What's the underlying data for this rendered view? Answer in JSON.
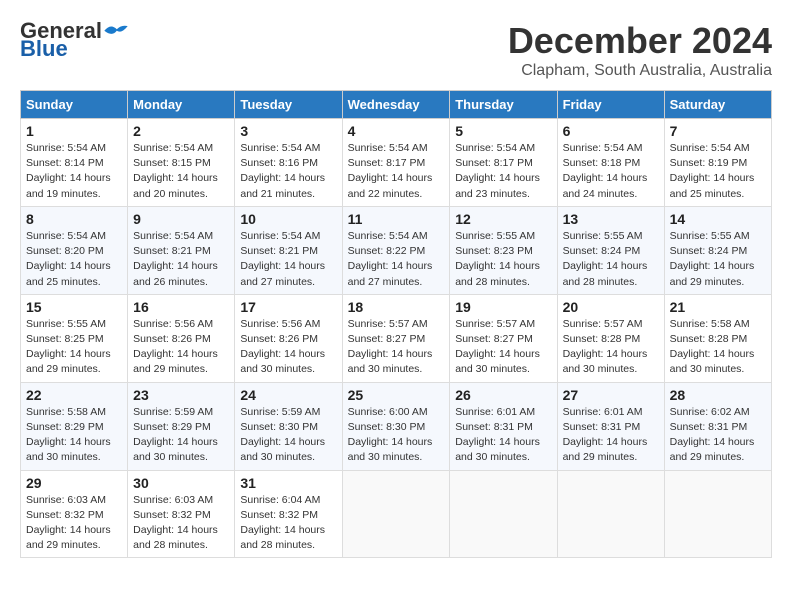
{
  "header": {
    "logo_general": "General",
    "logo_blue": "Blue",
    "month_title": "December 2024",
    "location": "Clapham, South Australia, Australia"
  },
  "weekdays": [
    "Sunday",
    "Monday",
    "Tuesday",
    "Wednesday",
    "Thursday",
    "Friday",
    "Saturday"
  ],
  "weeks": [
    [
      {
        "day": "1",
        "sunrise": "5:54 AM",
        "sunset": "8:14 PM",
        "daylight": "14 hours and 19 minutes."
      },
      {
        "day": "2",
        "sunrise": "5:54 AM",
        "sunset": "8:15 PM",
        "daylight": "14 hours and 20 minutes."
      },
      {
        "day": "3",
        "sunrise": "5:54 AM",
        "sunset": "8:16 PM",
        "daylight": "14 hours and 21 minutes."
      },
      {
        "day": "4",
        "sunrise": "5:54 AM",
        "sunset": "8:17 PM",
        "daylight": "14 hours and 22 minutes."
      },
      {
        "day": "5",
        "sunrise": "5:54 AM",
        "sunset": "8:17 PM",
        "daylight": "14 hours and 23 minutes."
      },
      {
        "day": "6",
        "sunrise": "5:54 AM",
        "sunset": "8:18 PM",
        "daylight": "14 hours and 24 minutes."
      },
      {
        "day": "7",
        "sunrise": "5:54 AM",
        "sunset": "8:19 PM",
        "daylight": "14 hours and 25 minutes."
      }
    ],
    [
      {
        "day": "8",
        "sunrise": "5:54 AM",
        "sunset": "8:20 PM",
        "daylight": "14 hours and 25 minutes."
      },
      {
        "day": "9",
        "sunrise": "5:54 AM",
        "sunset": "8:21 PM",
        "daylight": "14 hours and 26 minutes."
      },
      {
        "day": "10",
        "sunrise": "5:54 AM",
        "sunset": "8:21 PM",
        "daylight": "14 hours and 27 minutes."
      },
      {
        "day": "11",
        "sunrise": "5:54 AM",
        "sunset": "8:22 PM",
        "daylight": "14 hours and 27 minutes."
      },
      {
        "day": "12",
        "sunrise": "5:55 AM",
        "sunset": "8:23 PM",
        "daylight": "14 hours and 28 minutes."
      },
      {
        "day": "13",
        "sunrise": "5:55 AM",
        "sunset": "8:24 PM",
        "daylight": "14 hours and 28 minutes."
      },
      {
        "day": "14",
        "sunrise": "5:55 AM",
        "sunset": "8:24 PM",
        "daylight": "14 hours and 29 minutes."
      }
    ],
    [
      {
        "day": "15",
        "sunrise": "5:55 AM",
        "sunset": "8:25 PM",
        "daylight": "14 hours and 29 minutes."
      },
      {
        "day": "16",
        "sunrise": "5:56 AM",
        "sunset": "8:26 PM",
        "daylight": "14 hours and 29 minutes."
      },
      {
        "day": "17",
        "sunrise": "5:56 AM",
        "sunset": "8:26 PM",
        "daylight": "14 hours and 30 minutes."
      },
      {
        "day": "18",
        "sunrise": "5:57 AM",
        "sunset": "8:27 PM",
        "daylight": "14 hours and 30 minutes."
      },
      {
        "day": "19",
        "sunrise": "5:57 AM",
        "sunset": "8:27 PM",
        "daylight": "14 hours and 30 minutes."
      },
      {
        "day": "20",
        "sunrise": "5:57 AM",
        "sunset": "8:28 PM",
        "daylight": "14 hours and 30 minutes."
      },
      {
        "day": "21",
        "sunrise": "5:58 AM",
        "sunset": "8:28 PM",
        "daylight": "14 hours and 30 minutes."
      }
    ],
    [
      {
        "day": "22",
        "sunrise": "5:58 AM",
        "sunset": "8:29 PM",
        "daylight": "14 hours and 30 minutes."
      },
      {
        "day": "23",
        "sunrise": "5:59 AM",
        "sunset": "8:29 PM",
        "daylight": "14 hours and 30 minutes."
      },
      {
        "day": "24",
        "sunrise": "5:59 AM",
        "sunset": "8:30 PM",
        "daylight": "14 hours and 30 minutes."
      },
      {
        "day": "25",
        "sunrise": "6:00 AM",
        "sunset": "8:30 PM",
        "daylight": "14 hours and 30 minutes."
      },
      {
        "day": "26",
        "sunrise": "6:01 AM",
        "sunset": "8:31 PM",
        "daylight": "14 hours and 30 minutes."
      },
      {
        "day": "27",
        "sunrise": "6:01 AM",
        "sunset": "8:31 PM",
        "daylight": "14 hours and 29 minutes."
      },
      {
        "day": "28",
        "sunrise": "6:02 AM",
        "sunset": "8:31 PM",
        "daylight": "14 hours and 29 minutes."
      }
    ],
    [
      {
        "day": "29",
        "sunrise": "6:03 AM",
        "sunset": "8:32 PM",
        "daylight": "14 hours and 29 minutes."
      },
      {
        "day": "30",
        "sunrise": "6:03 AM",
        "sunset": "8:32 PM",
        "daylight": "14 hours and 28 minutes."
      },
      {
        "day": "31",
        "sunrise": "6:04 AM",
        "sunset": "8:32 PM",
        "daylight": "14 hours and 28 minutes."
      },
      null,
      null,
      null,
      null
    ]
  ]
}
